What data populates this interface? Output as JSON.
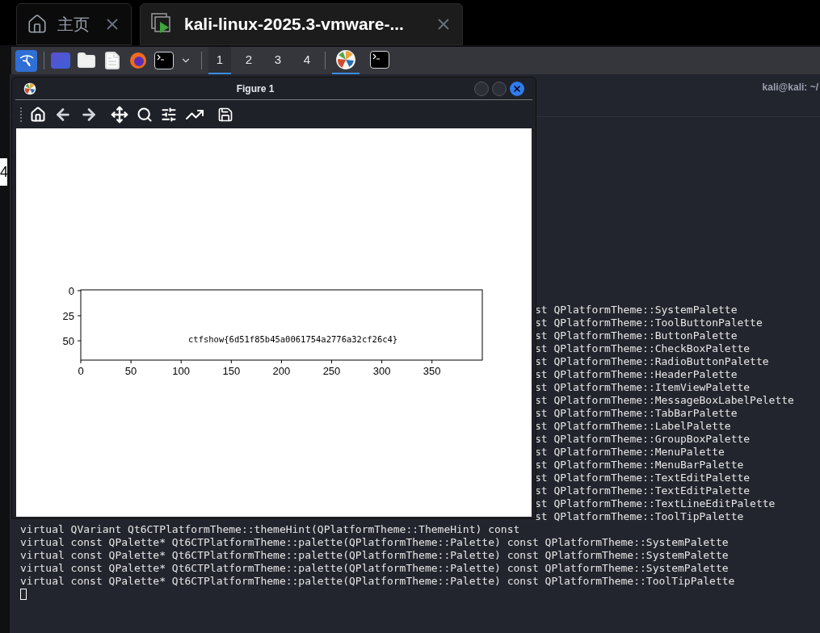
{
  "browser_tabs": [
    {
      "label": "主页",
      "selected": false
    },
    {
      "label": "kali-linux-2025.3-vmware-...",
      "selected": true
    }
  ],
  "left_edge": {
    "fragment": "4"
  },
  "taskbar": {
    "workspaces": [
      {
        "label": "1",
        "selected": true
      },
      {
        "label": "2",
        "selected": false
      },
      {
        "label": "3",
        "selected": false
      },
      {
        "label": "4",
        "selected": false
      }
    ],
    "running": [
      {
        "kind": "plot",
        "selected": true
      },
      {
        "kind": "terminal",
        "selected": false
      }
    ]
  },
  "terminal": {
    "title": "kali@kali: ~/",
    "lines": [
      {
        "kind": "partial",
        "text": "st QPlatformTheme::SystemPalette"
      },
      {
        "kind": "partial",
        "text": "st QPlatformTheme::ToolButtonPalette"
      },
      {
        "kind": "partial",
        "text": "st QPlatformTheme::ButtonPalette"
      },
      {
        "kind": "partial",
        "text": "st QPlatformTheme::CheckBoxPalette"
      },
      {
        "kind": "partial",
        "text": "st QPlatformTheme::RadioButtonPalette"
      },
      {
        "kind": "partial",
        "text": "st QPlatformTheme::HeaderPalette"
      },
      {
        "kind": "partial",
        "text": "st QPlatformTheme::ItemViewPalette"
      },
      {
        "kind": "partial",
        "text": "st QPlatformTheme::MessageBoxLabelPelette"
      },
      {
        "kind": "partial",
        "text": "st QPlatformTheme::TabBarPalette"
      },
      {
        "kind": "partial",
        "text": "st QPlatformTheme::LabelPalette"
      },
      {
        "kind": "partial",
        "text": "st QPlatformTheme::GroupBoxPalette"
      },
      {
        "kind": "partial",
        "text": "st QPlatformTheme::MenuPalette"
      },
      {
        "kind": "partial",
        "text": "st QPlatformTheme::MenuBarPalette"
      },
      {
        "kind": "partial",
        "text": "st QPlatformTheme::TextEditPalette"
      },
      {
        "kind": "partial",
        "text": "st QPlatformTheme::TextEditPalette"
      },
      {
        "kind": "partial",
        "text": "st QPlatformTheme::TextLineEditPalette"
      },
      {
        "kind": "partial",
        "text": "st QPlatformTheme::ToolTipPalette"
      },
      {
        "kind": "full",
        "text": "virtual QVariant Qt6CTPlatformTheme::themeHint(QPlatformTheme::ThemeHint) const"
      },
      {
        "kind": "full",
        "text": "virtual const QPalette* Qt6CTPlatformTheme::palette(QPlatformTheme::Palette) const QPlatformTheme::SystemPalette"
      },
      {
        "kind": "full",
        "text": "virtual const QPalette* Qt6CTPlatformTheme::palette(QPlatformTheme::Palette) const QPlatformTheme::SystemPalette"
      },
      {
        "kind": "full",
        "text": "virtual const QPalette* Qt6CTPlatformTheme::palette(QPlatformTheme::Palette) const QPlatformTheme::SystemPalette"
      },
      {
        "kind": "full",
        "text": "virtual const QPalette* Qt6CTPlatformTheme::palette(QPlatformTheme::Palette) const QPlatformTheme::ToolTipPalette"
      }
    ]
  },
  "figure_window": {
    "title": "Figure 1",
    "plot": {
      "xticks": [
        "0",
        "50",
        "100",
        "150",
        "200",
        "250",
        "300",
        "350"
      ],
      "yticks": [
        "0",
        "25",
        "50"
      ],
      "image_text": "ctfshow{6d51f85b45a0061754a2776a32cf26c4}"
    }
  }
}
